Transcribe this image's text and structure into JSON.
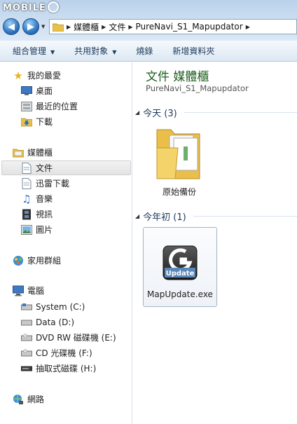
{
  "watermark": {
    "text": "MOBILE"
  },
  "address": {
    "crumbs": [
      "媒體櫃",
      "文件",
      "PureNavi_S1_Mapupdator"
    ]
  },
  "toolbar": {
    "organize": "組合管理",
    "share": "共用對象",
    "burn": "燒錄",
    "new_folder": "新增資料夾"
  },
  "nav": {
    "favorites": {
      "title": "我的最愛",
      "items": [
        "桌面",
        "最近的位置",
        "下載"
      ]
    },
    "libraries": {
      "title": "媒體櫃",
      "items": [
        "文件",
        "迅雷下載",
        "音樂",
        "視訊",
        "圖片"
      ]
    },
    "homegroup": {
      "title": "家用群組"
    },
    "computer": {
      "title": "電腦",
      "items": [
        "System (C:)",
        "Data (D:)",
        "DVD RW 磁碟機 (E:)",
        "CD 光碟機 (F:)",
        "抽取式磁碟 (H:)"
      ]
    },
    "network": {
      "title": "網路"
    }
  },
  "content": {
    "title": "文件 媒體櫃",
    "subtitle": "PureNavi_S1_Mapupdator",
    "groups": [
      {
        "label": "今天 (3)",
        "items": [
          {
            "name": "原始備份",
            "icon": "folder-icon"
          }
        ]
      },
      {
        "label": "今年初 (1)",
        "items": [
          {
            "name": "MapUpdate.exe",
            "icon": "update-app-icon",
            "badge": "Update"
          }
        ]
      }
    ]
  },
  "colors": {
    "library_title": "#1e5e1e",
    "toolbar_text": "#1e395b",
    "titlebar": "#c9dcf0"
  }
}
